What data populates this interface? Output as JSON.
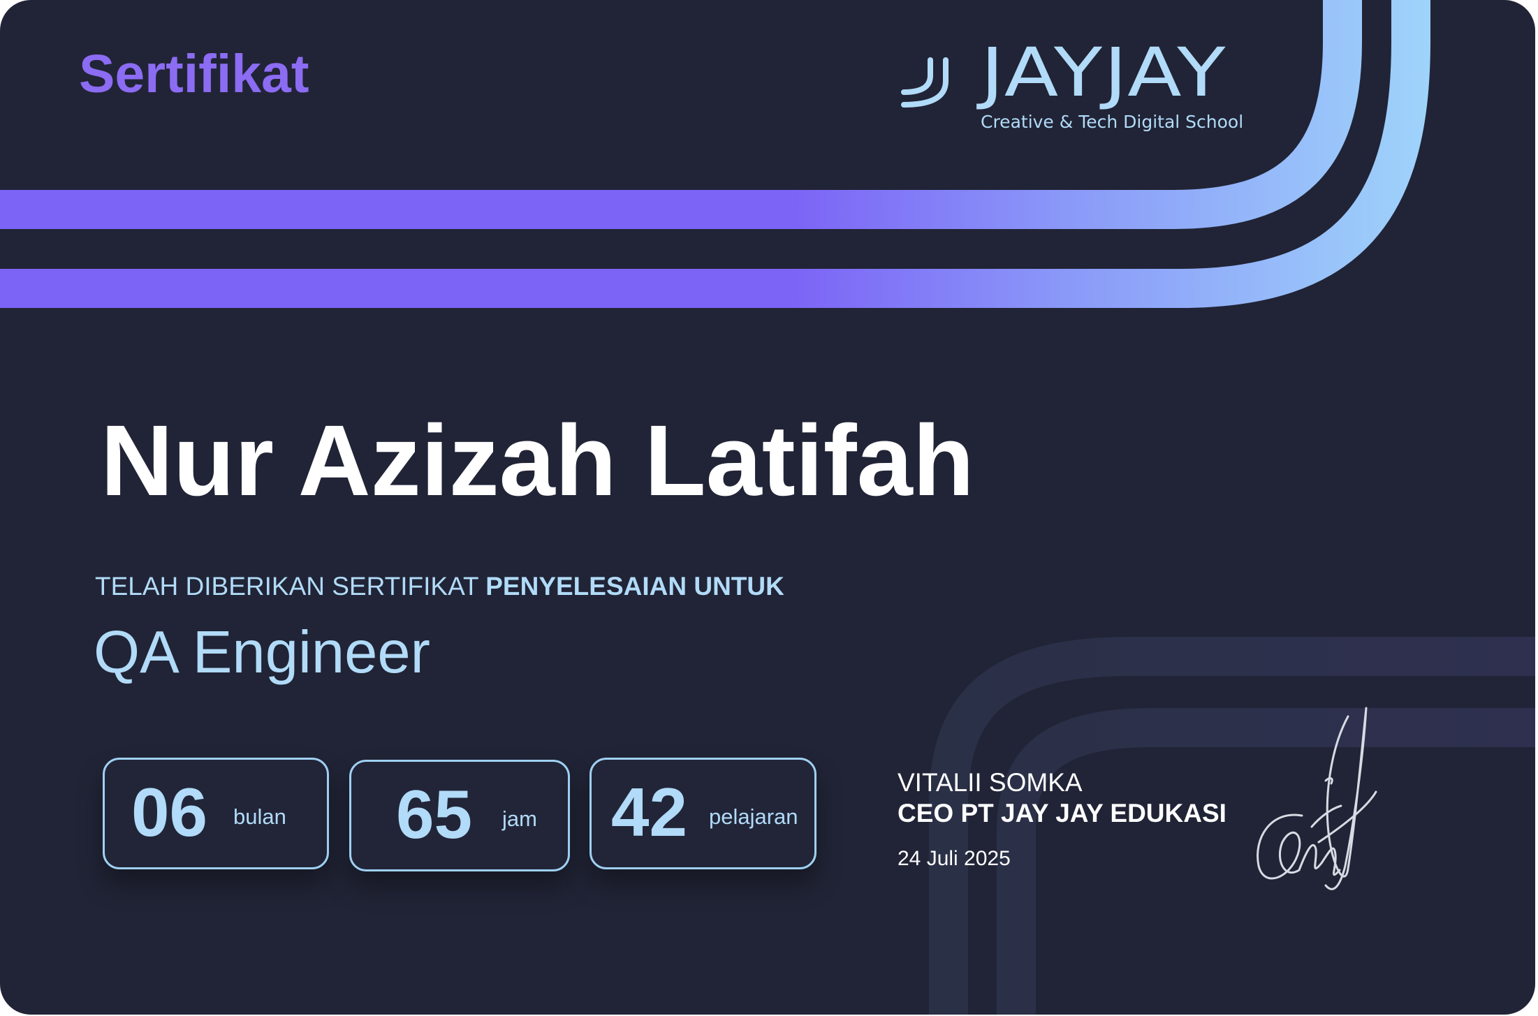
{
  "certificate": {
    "heading": "Sertifikat",
    "recipient_name": "Nur Azizah Latifah",
    "intro_regular": "TELAH DIBERIKAN SERTIFIKAT ",
    "intro_bold": "PENYELESAIAN UNTUK",
    "program": "QA Engineer",
    "issue_date": "24 Juli 2025"
  },
  "brand": {
    "wordmark": "JAYJAY",
    "tagline": "Creative & Tech Digital School",
    "logo_icon": "double-j-icon"
  },
  "stats": [
    {
      "value": "06",
      "unit": "bulan"
    },
    {
      "value": "65",
      "unit": "jam"
    },
    {
      "value": "42",
      "unit": "pelajaran"
    }
  ],
  "signer": {
    "name": "VITALII SOMKA",
    "role": "CEO PT JAY JAY EDUKASI",
    "signature_icon": "handwritten-signature"
  },
  "colors": {
    "background": "#212436",
    "heading": "#8b6cf3",
    "accent_purple": "#7c64f6",
    "accent_blue": "#9fd5fb",
    "light_blue_text": "#b1dbf8",
    "white": "#ffffff",
    "faint_band": "#2c3148"
  }
}
